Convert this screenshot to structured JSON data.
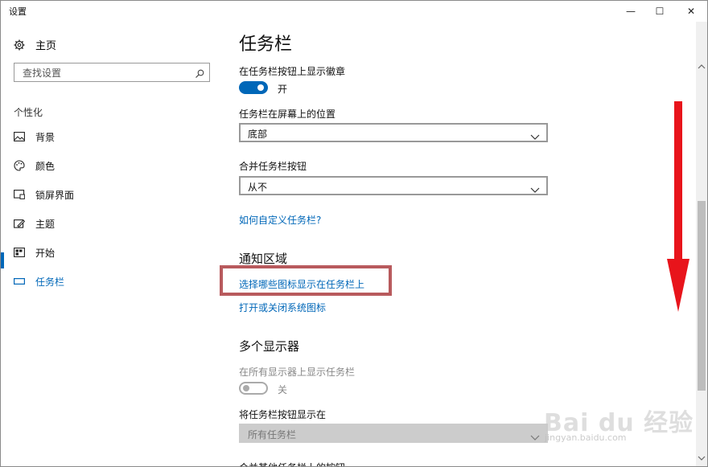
{
  "window": {
    "title": "设置",
    "minimize_glyph": "—",
    "maximize_glyph": "☐",
    "close_glyph": "✕"
  },
  "sidebar": {
    "home_label": "主页",
    "search_placeholder": "查找设置",
    "section_label": "个性化",
    "items": [
      {
        "label": "背景",
        "icon": "picture-icon"
      },
      {
        "label": "颜色",
        "icon": "palette-icon"
      },
      {
        "label": "锁屏界面",
        "icon": "lock-screen-icon"
      },
      {
        "label": "主题",
        "icon": "theme-icon"
      },
      {
        "label": "开始",
        "icon": "start-icon"
      },
      {
        "label": "任务栏",
        "icon": "taskbar-icon",
        "active": true
      }
    ]
  },
  "main": {
    "title": "任务栏",
    "badges": {
      "label": "在任务栏按钮上显示徽章",
      "state_text": "开",
      "on": true
    },
    "position": {
      "label": "任务栏在屏幕上的位置",
      "value": "底部"
    },
    "combine": {
      "label": "合并任务栏按钮",
      "value": "从不"
    },
    "customize_link": "如何自定义任务栏?",
    "notification": {
      "heading": "通知区域",
      "link_icons": "选择哪些图标显示在任务栏上",
      "link_system": "打开或关闭系统图标"
    },
    "multi_display": {
      "heading": "多个显示器",
      "show_all_label": "在所有显示器上显示任务栏",
      "show_all_state": "关",
      "show_all_on": false,
      "buttons_label": "将任务栏按钮显示在",
      "buttons_value": "所有任务栏",
      "combine_other_label": "合并其他任务栏上的按钮"
    }
  },
  "watermark": {
    "brand": "Bai du 经验",
    "url": "jingyan.baidu.com"
  },
  "colors": {
    "accent": "#0067b8",
    "highlight_box": "#b85a5d",
    "arrow": "#e8141b"
  }
}
